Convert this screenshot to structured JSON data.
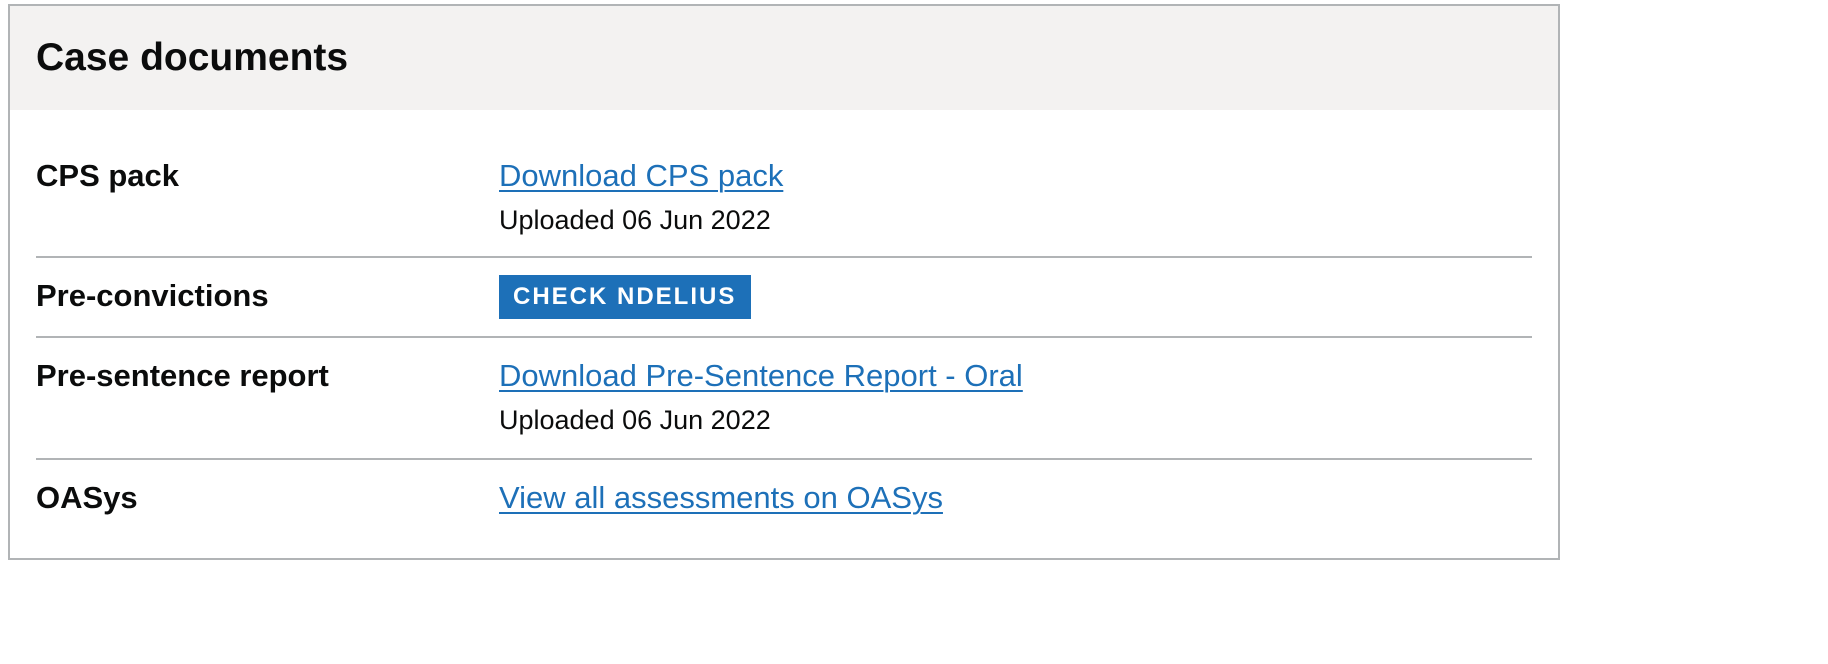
{
  "card": {
    "title": "Case documents"
  },
  "rows": [
    {
      "label": "CPS pack",
      "link": "Download CPS pack",
      "uploaded": "Uploaded 06 Jun 2022"
    },
    {
      "label": "Pre-convictions",
      "button": "CHECK NDELIUS"
    },
    {
      "label": "Pre-sentence report",
      "link": "Download Pre-Sentence Report - Oral",
      "uploaded": "Uploaded 06 Jun 2022"
    },
    {
      "label": "OASys",
      "link": "View all assessments on OASys"
    }
  ],
  "colors": {
    "link": "#1d70b8",
    "header_background": "#f3f2f1",
    "border": "#b1b4b6",
    "text": "#0b0c0c",
    "button_background": "#1d70b8",
    "button_text": "#ffffff"
  }
}
